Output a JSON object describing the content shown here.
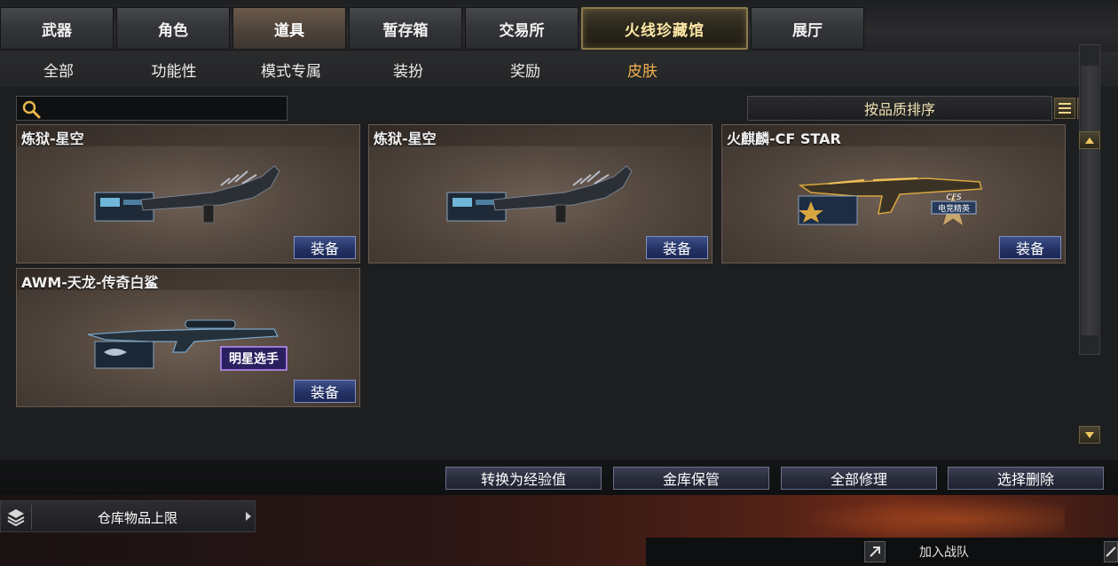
{
  "main_tabs": [
    "武器",
    "角色",
    "道具",
    "暂存箱",
    "交易所",
    "火线珍藏馆",
    "展厅"
  ],
  "main_tab_active": "道具",
  "sub_tabs": [
    "全部",
    "功能性",
    "模式专属",
    "装扮",
    "奖励",
    "皮肤"
  ],
  "sub_tab_active": "皮肤",
  "search": {
    "value": "",
    "placeholder": ""
  },
  "sort": {
    "label": "按品质排序"
  },
  "items": [
    {
      "name": "炼狱-星空",
      "action": "装备",
      "icon": "serpent-rifle-icon"
    },
    {
      "name": "炼狱-星空",
      "action": "装备",
      "icon": "serpent-rifle-icon"
    },
    {
      "name": "火麒麟-CF STAR",
      "action": "装备",
      "icon": "golden-ak-icon"
    },
    {
      "name": "AWM-天龙-传奇白鲨",
      "action": "装备",
      "icon": "sniper-rifle-icon"
    }
  ],
  "item_badges": {
    "star_badge": "明星选手",
    "cfs_badge": "电竞精英",
    "cfs_logo": "CFS"
  },
  "actions": {
    "convert": "转换为经验值",
    "vault": "金库保管",
    "repair": "全部修理",
    "delete": "选择删除"
  },
  "stock_limit": {
    "label": "仓库物品上限"
  },
  "team": {
    "join_label": "加入战队"
  },
  "colors": {
    "active_subtab": "#f3b24f",
    "equip_button": "#243266",
    "vault_tab_border": "#8c7a4a"
  }
}
